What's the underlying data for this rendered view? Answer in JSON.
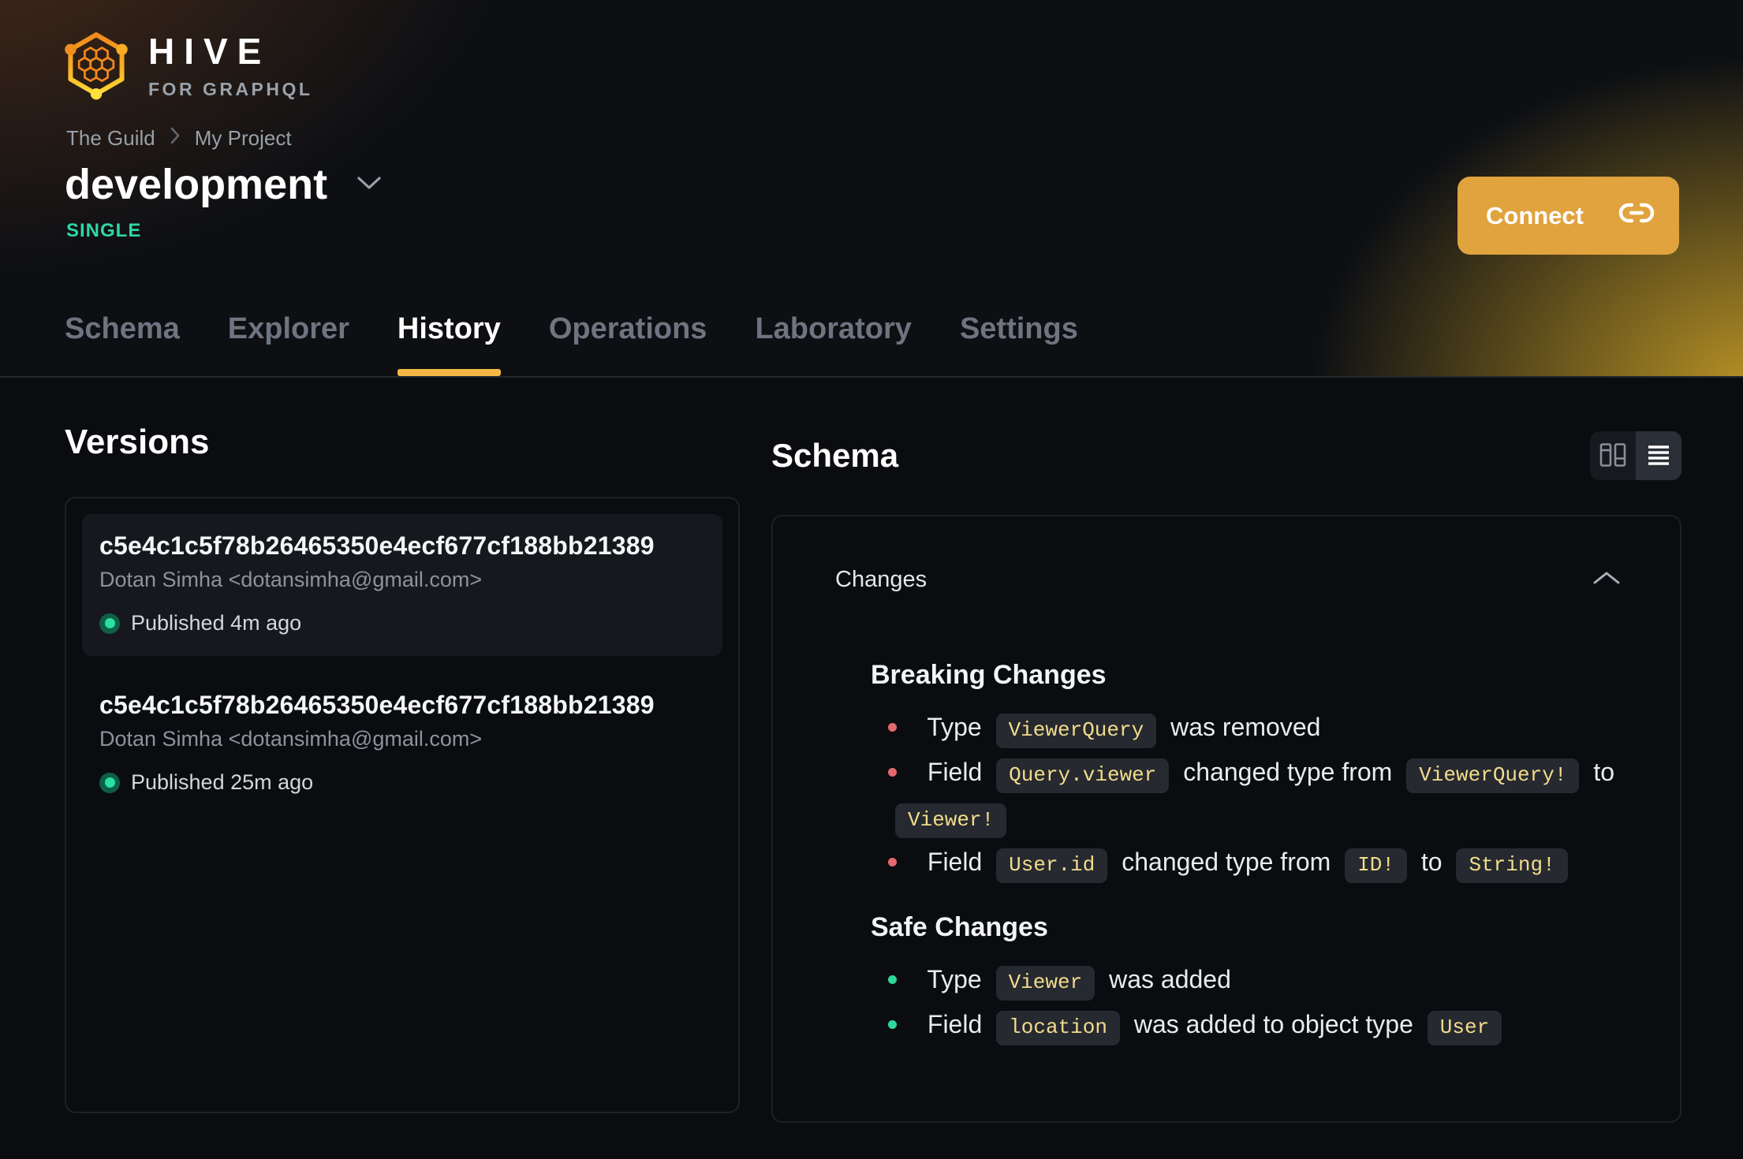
{
  "brand": {
    "name": "HIVE",
    "tagline": "FOR GRAPHQL"
  },
  "breadcrumb": {
    "items": [
      "The Guild",
      "My Project"
    ]
  },
  "project": {
    "name": "development",
    "badge": "SINGLE"
  },
  "actions": {
    "connect_label": "Connect"
  },
  "tabs": [
    {
      "label": "Schema",
      "active": false
    },
    {
      "label": "Explorer",
      "active": false
    },
    {
      "label": "History",
      "active": true
    },
    {
      "label": "Operations",
      "active": false
    },
    {
      "label": "Laboratory",
      "active": false
    },
    {
      "label": "Settings",
      "active": false
    }
  ],
  "versions": {
    "title": "Versions",
    "items": [
      {
        "hash": "c5e4c1c5f78b26465350e4ecf677cf188bb21389",
        "author": "Dotan Simha <dotansimha@gmail.com>",
        "status": "Published 4m ago",
        "highlighted": true
      },
      {
        "hash": "c5e4c1c5f78b26465350e4ecf677cf188bb21389",
        "author": "Dotan Simha <dotansimha@gmail.com>",
        "status": "Published 25m ago",
        "highlighted": false
      }
    ]
  },
  "schema_panel": {
    "title": "Schema",
    "view_toggle": [
      {
        "name": "columns-view",
        "active": false
      },
      {
        "name": "list-view",
        "active": true
      }
    ],
    "changes": {
      "title": "Changes",
      "groups": [
        {
          "title": "Breaking Changes",
          "kind": "breaking",
          "items": [
            {
              "segments": [
                {
                  "t": "text",
                  "v": "Type"
                },
                {
                  "t": "code",
                  "v": "ViewerQuery"
                },
                {
                  "t": "text",
                  "v": "was removed"
                }
              ]
            },
            {
              "segments": [
                {
                  "t": "text",
                  "v": "Field"
                },
                {
                  "t": "code",
                  "v": "Query.viewer"
                },
                {
                  "t": "text",
                  "v": "changed type from"
                },
                {
                  "t": "code",
                  "v": "ViewerQuery!"
                },
                {
                  "t": "text",
                  "v": "to"
                },
                {
                  "t": "code",
                  "v": "Viewer!"
                }
              ]
            },
            {
              "segments": [
                {
                  "t": "text",
                  "v": "Field"
                },
                {
                  "t": "code",
                  "v": "User.id"
                },
                {
                  "t": "text",
                  "v": "changed type from"
                },
                {
                  "t": "code",
                  "v": "ID!"
                },
                {
                  "t": "text",
                  "v": "to"
                },
                {
                  "t": "code",
                  "v": "String!"
                }
              ]
            }
          ]
        },
        {
          "title": "Safe Changes",
          "kind": "safe",
          "items": [
            {
              "segments": [
                {
                  "t": "text",
                  "v": "Type"
                },
                {
                  "t": "code",
                  "v": "Viewer"
                },
                {
                  "t": "text",
                  "v": "was added"
                }
              ]
            },
            {
              "segments": [
                {
                  "t": "text",
                  "v": "Field"
                },
                {
                  "t": "code",
                  "v": "location"
                },
                {
                  "t": "text",
                  "v": "was added to object type"
                },
                {
                  "t": "code",
                  "v": "User"
                }
              ]
            }
          ]
        }
      ]
    }
  },
  "colors": {
    "accent": "#f5b844",
    "connect": "#e0a33e",
    "badge": "#2fd7a0",
    "breaking": "#e4696f",
    "safe": "#2fd79a",
    "code": "#f2dc8c"
  }
}
